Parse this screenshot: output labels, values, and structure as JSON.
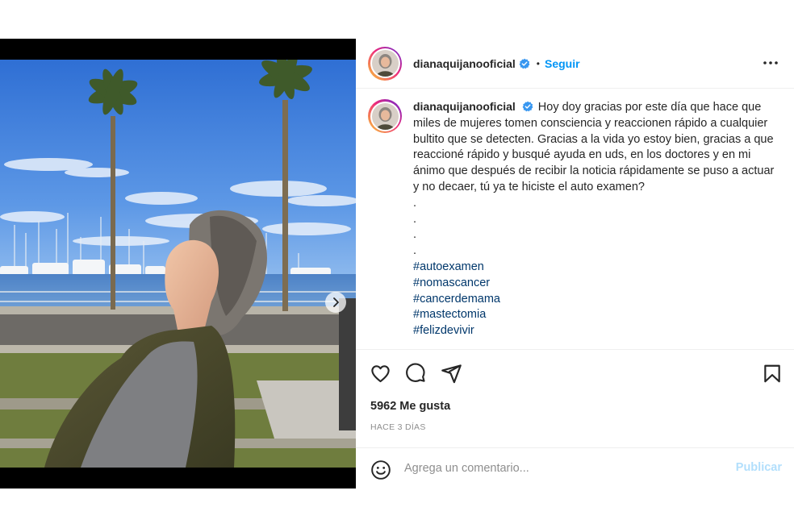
{
  "post": {
    "media": {
      "image_alt": "Mujer con los ojos cerrados y el rostro hacia el sol frente a una marina con palmeras",
      "carousel_total": 3,
      "carousel_active": 1,
      "next_icon": "chevron-right-icon"
    },
    "header": {
      "username": "dianaquijanooficial",
      "verified_icon": "verified-badge-icon",
      "separator": "•",
      "follow_label": "Seguir",
      "more_icon": "more-horizontal-icon"
    },
    "caption": {
      "username": "dianaquijanooficial",
      "text": "Hoy doy gracias por este día que hace que miles de mujeres tomen consciencia y reaccionen rápido a cualquier bultito que se detecten. Gracias a la vida yo estoy bien, gracias a que reaccioné rápido y busqué ayuda en uds, en los doctores y en mi ánimo que después de recibir la noticia rápidamente se puso a actuar y no decaer, tú ya te hiciste el auto examen?",
      "dots": [
        ".",
        ".",
        ".",
        "."
      ],
      "hashtags": [
        "#autoexamen",
        "#nomascancer",
        "#cancerdemama",
        "#mastectomia",
        "#felizdevivir"
      ]
    },
    "actions": {
      "like_icon": "heart-icon",
      "comment_icon": "comment-icon",
      "share_icon": "paper-plane-icon",
      "save_icon": "bookmark-icon"
    },
    "likes_text": "5962 Me gusta",
    "timestamp": "HACE 3 DÍAS",
    "comment": {
      "emoji_icon": "emoji-icon",
      "placeholder": "Agrega un comentario...",
      "value": "",
      "publish_label": "Publicar"
    },
    "colors": {
      "accent": "#0095f6",
      "hashtag": "#00376b",
      "publish_disabled": "#b2dffc",
      "muted": "#8e8e8e",
      "text": "#262626"
    }
  }
}
